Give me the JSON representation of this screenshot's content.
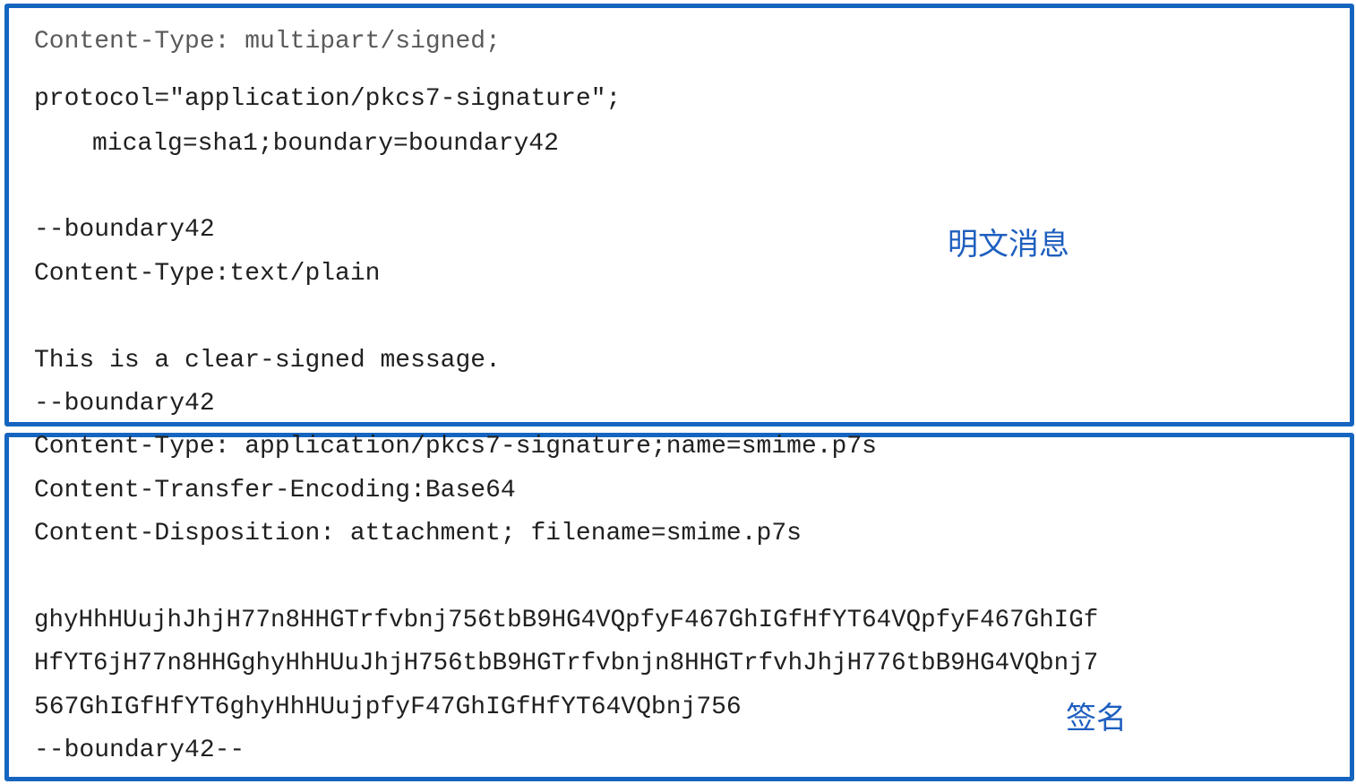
{
  "plaintext_section": {
    "label": "明文消息",
    "lines": [
      "Content-Type: multipart/signed;",
      "protocol=\"application/pkcs7-signature\";",
      "micalg=sha1;boundary=boundary42",
      "--boundary42",
      "Content-Type:text/plain",
      "This is a clear-signed message.",
      "--boundary42"
    ]
  },
  "signature_section": {
    "label": "签名",
    "lines": [
      "Content-Type: application/pkcs7-signature;name=smime.p7s",
      "Content-Transfer-Encoding:Base64",
      "Content-Disposition: attachment; filename=smime.p7s",
      "ghyHhHUujhJhjH77n8HHGTrfvbnj756tbB9HG4VQpfyF467GhIGfHfYT64VQpfyF467GhIGf",
      "HfYT6jH77n8HHGghyHhHUuJhjH756tbB9HGTrfvbnjn8HHGTrfvhJhjH776tbB9HG4VQbnj7",
      "567GhIGfHfYT6ghyHhHUujpfyF47GhIGfHfYT64VQbnj756",
      "--boundary42--"
    ]
  },
  "colors": {
    "frame": "#1565c0",
    "label": "#1f5fbf",
    "text": "#202020"
  }
}
